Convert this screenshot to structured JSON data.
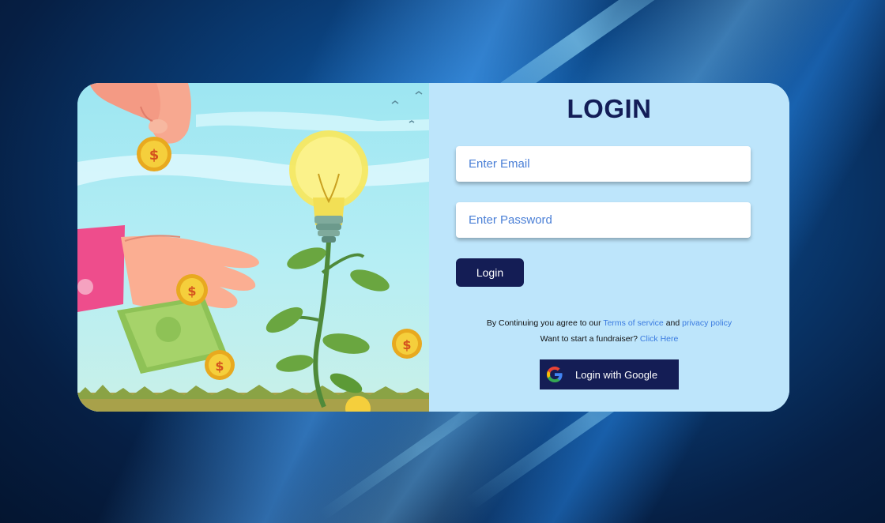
{
  "login": {
    "title": "LOGIN",
    "email_placeholder": "Enter Email",
    "password_placeholder": "Enter Password",
    "login_label": "Login",
    "terms_prefix": "By Continuing you agree to our",
    "terms_link": "Terms of service",
    "terms_and": "and",
    "privacy_link": "privacy policy",
    "fundraiser_prefix": "Want to start a fundraiser?",
    "fundraiser_link": "Click Here",
    "google_label": "Login with Google"
  },
  "colors": {
    "primary": "#141d55",
    "panel": "#bde5fb",
    "link": "#3a7be0"
  },
  "icons": {
    "google": "google-icon",
    "illustration": "money-growth-illustration"
  }
}
